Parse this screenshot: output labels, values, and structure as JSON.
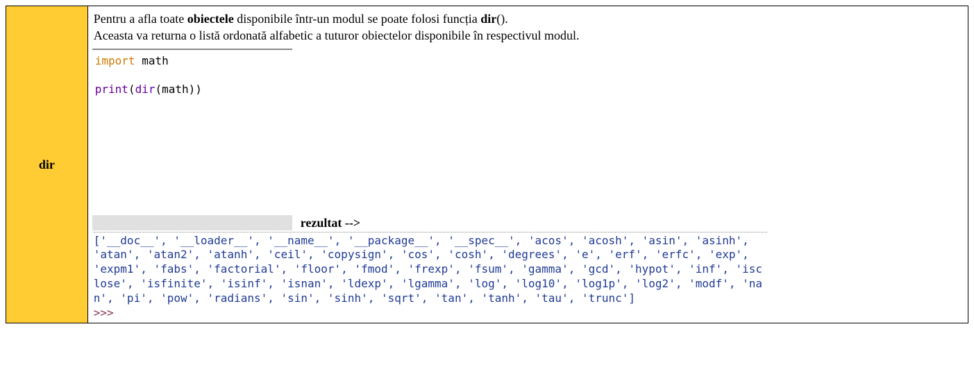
{
  "label": "dir",
  "description": {
    "line1_pre": "Pentru a afla toate ",
    "line1_bold1": "obiectele",
    "line1_mid": " disponibile într-un modul se poate folosi funcția ",
    "line1_bold2": "dir",
    "line1_post": "().",
    "line2": "Aceasta va returna o listă ordonată alfabetic a tuturor obiectelor disponibile în respectivul modul."
  },
  "code": {
    "kw_import": "import",
    "module": " math",
    "fn_print": "print",
    "kw_dir": "dir",
    "paren_open": "(",
    "arg": "(math))"
  },
  "result_label": "rezultat -->",
  "output_list": "['__doc__', '__loader__', '__name__', '__package__', '__spec__', 'acos', 'acosh', 'asin', 'asinh', 'atan', 'atan2', 'atanh', 'ceil', 'copysign', 'cos', 'cosh', 'degrees', 'e', 'erf', 'erfc', 'exp', 'expm1', 'fabs', 'factorial', 'floor', 'fmod', 'frexp', 'fsum', 'gamma', 'gcd', 'hypot', 'inf', 'isclose', 'isfinite', 'isinf', 'isnan', 'ldexp', 'lgamma', 'log', 'log10', 'log1p', 'log2', 'modf', 'nan', 'pi', 'pow', 'radians', 'sin', 'sinh', 'sqrt', 'tan', 'tanh', 'tau', 'trunc']",
  "prompt": ">>>"
}
